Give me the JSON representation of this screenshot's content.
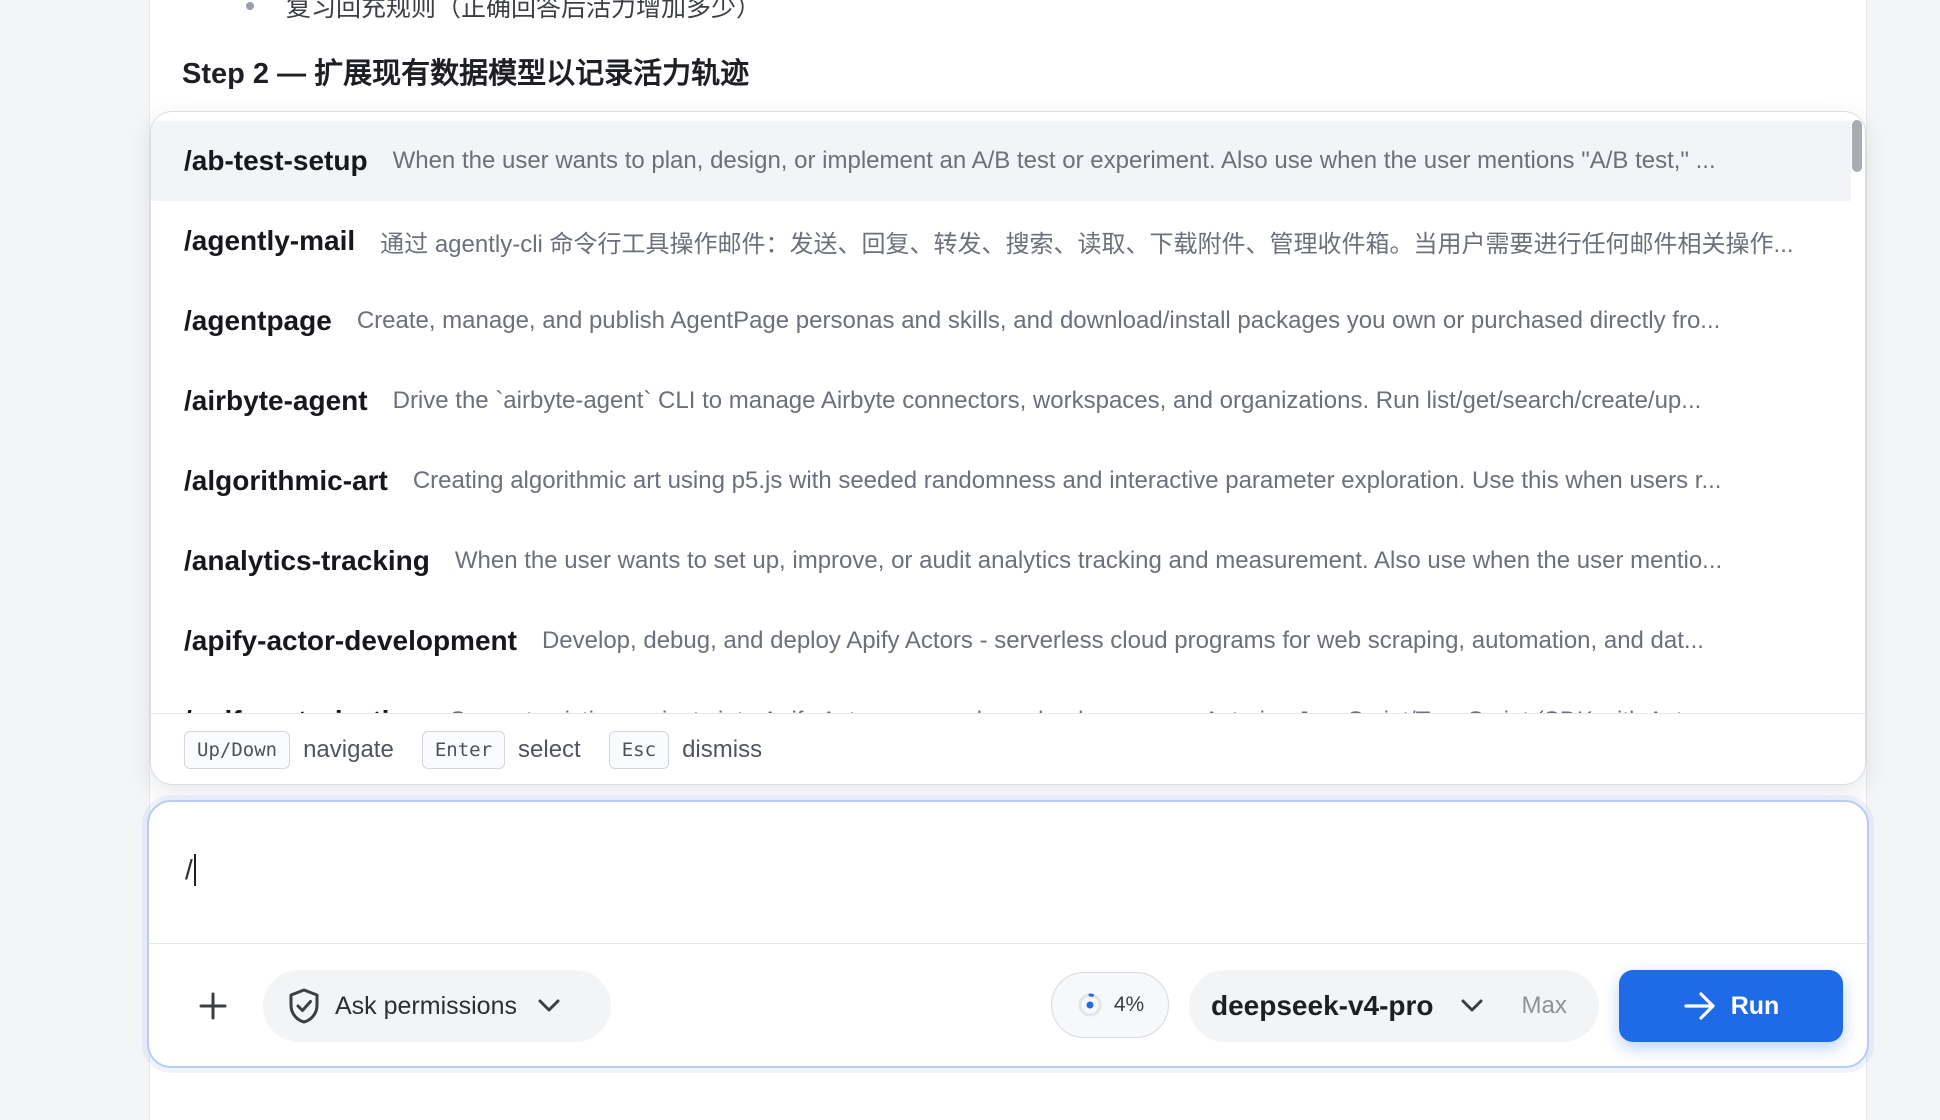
{
  "document": {
    "bullet_text": "复习回充规则（正确回答后活力增加多少）",
    "step_heading": "Step 2 — 扩展现有数据模型以记录活力轨迹"
  },
  "command_popup": {
    "items": [
      {
        "name": "/ab-test-setup",
        "description": "When the user wants to plan, design, or implement an A/B test or experiment. Also use when the user mentions \"A/B test,\" ...",
        "active": true
      },
      {
        "name": "/agently-mail",
        "description": "通过 agently-cli 命令行工具操作邮件：发送、回复、转发、搜索、读取、下载附件、管理收件箱。当用户需要进行任何邮件相关操作...",
        "active": false
      },
      {
        "name": "/agentpage",
        "description": "Create, manage, and publish AgentPage personas and skills, and download/install packages you own or purchased directly fro...",
        "active": false
      },
      {
        "name": "/airbyte-agent",
        "description": "Drive the `airbyte-agent` CLI to manage Airbyte connectors, workspaces, and organizations. Run list/get/search/create/up...",
        "active": false
      },
      {
        "name": "/algorithmic-art",
        "description": "Creating algorithmic art using p5.js with seeded randomness and interactive parameter exploration. Use this when users r...",
        "active": false
      },
      {
        "name": "/analytics-tracking",
        "description": "When the user wants to set up, improve, or audit analytics tracking and measurement. Also use when the user mentio...",
        "active": false
      },
      {
        "name": "/apify-actor-development",
        "description": "Develop, debug, and deploy Apify Actors - serverless cloud programs for web scraping, automation, and dat...",
        "active": false
      },
      {
        "name": "/apify-actorization",
        "description": "Convert existing projects into Apify Actors - serverless cloud programs. Actorize JavaScript/TypeScript (SDK with Act...",
        "active": false
      }
    ],
    "footer": {
      "navigate_key": "Up/Down",
      "navigate_label": "navigate",
      "select_key": "Enter",
      "select_label": "select",
      "dismiss_key": "Esc",
      "dismiss_label": "dismiss"
    }
  },
  "composer": {
    "input_value": "/",
    "add_icon": "plus-icon",
    "permissions_label": "Ask permissions",
    "permissions_icon": "shield-check-icon",
    "context_usage": "4%",
    "model_name": "deepseek-v4-pro",
    "effort_label": "Max",
    "run_label": "Run",
    "accent_color": "#1f6ae6"
  }
}
